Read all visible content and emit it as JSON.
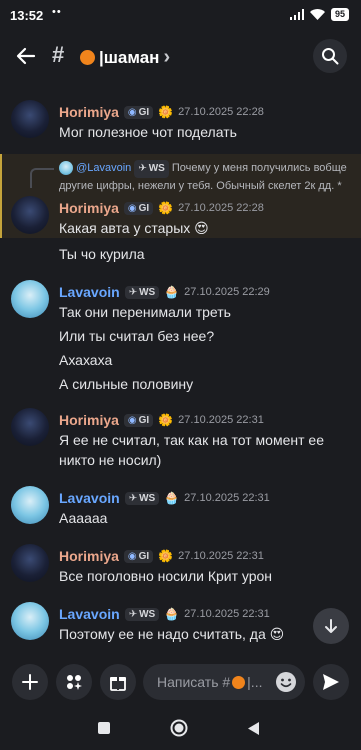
{
  "status": {
    "time": "13:52",
    "dots": "••",
    "battery": "95"
  },
  "header": {
    "hash": "#",
    "channel": "|шаман",
    "chevron": "›"
  },
  "colors": {
    "accent_orange": "#f0841c",
    "author_horimiya": "#eba78c",
    "author_lavavoin": "#69a7ff",
    "reply_highlight": "#c5a43b"
  },
  "messages": [
    {
      "author": "Horimiya",
      "tag": "GI",
      "time": "27.10.2025 22:28",
      "lines": [
        "Мог полезное чот поделать"
      ]
    },
    {
      "author": "Horimiya",
      "tag": "GI",
      "time": "27.10.2025 22:28",
      "reply": {
        "author": "@Lavavoin",
        "tag": "WS",
        "text": "Почему у меня получились вобще другие цифры, нежели у тебя. Обычный скелет 2к дд. *"
      },
      "lines": [
        "Какая авта у старых",
        "Ты чо курила"
      ]
    },
    {
      "author": "Lavavoin",
      "tag": "WS",
      "time": "27.10.2025 22:29",
      "lines": [
        "Так они перенимали треть",
        "Или ты считал без нее?",
        "Ахахаха",
        "А сильные половину"
      ]
    },
    {
      "author": "Horimiya",
      "tag": "GI",
      "time": "27.10.2025 22:31",
      "lines": [
        "Я ее не считал, так как на тот момент ее никто не носил)"
      ]
    },
    {
      "author": "Lavavoin",
      "tag": "WS",
      "time": "27.10.2025 22:31",
      "lines": [
        "Аааааа"
      ]
    },
    {
      "author": "Horimiya",
      "tag": "GI",
      "time": "27.10.2025 22:31",
      "lines": [
        "Все поголовно носили Крит урон"
      ]
    },
    {
      "author": "Lavavoin",
      "tag": "WS",
      "time": "27.10.2025 22:31",
      "lines": [
        "Поэтому ее не надо считать, да"
      ]
    }
  ],
  "composer": {
    "placeholder": "Написать #",
    "placeholder_tail": "|..."
  },
  "icons": [
    "arrow-left-icon",
    "search-icon",
    "plus-icon",
    "apps-icon",
    "gift-icon",
    "emoji-icon",
    "send-icon",
    "arrow-down-icon",
    "nav-square-icon",
    "nav-circle-icon",
    "nav-back-icon"
  ]
}
